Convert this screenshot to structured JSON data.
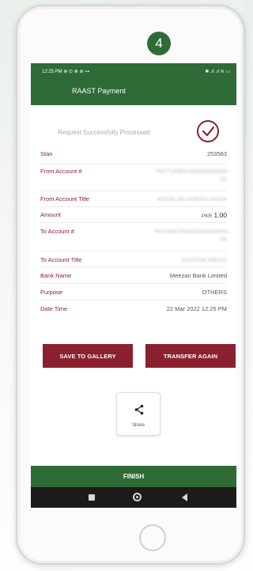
{
  "step_number": "4",
  "status_bar": {
    "time": "12:25 PM",
    "left_icons": "⊕ ⊙ ⊗ ⊛ ⊶",
    "right_icons": "✱ .ıl .ıl ≋ ▭"
  },
  "header": {
    "title": "RAAST Payment"
  },
  "status_message": "Request Successfully Processed",
  "rows": [
    {
      "label": "Stan",
      "value": "253583"
    },
    {
      "label": "From Account #",
      "value": "PK07UMBK000000000956-00",
      "blurred": true
    },
    {
      "label": "From Account Title",
      "value": "ARSALAN SHEIKH KHAN",
      "blurred": true
    },
    {
      "label": "Amount",
      "currency": "PKR",
      "amount": "1.00"
    },
    {
      "label": "To Account #",
      "value": "PK07MEZN0003260409054 - 00",
      "blurred": true
    },
    {
      "label": "To Account Title",
      "value": "SADDAM MIEAD",
      "blurred": true
    },
    {
      "label": "Bank Name",
      "value": "Meezan Bank Limited"
    },
    {
      "label": "Purpose",
      "value": "OTHERS"
    },
    {
      "label": "Date Time",
      "value": "22 Mar 2022 12:25 PM"
    }
  ],
  "buttons": {
    "save": "SAVE TO GALLERY",
    "transfer": "TRANSFER AGAIN"
  },
  "share": {
    "label": "Share"
  },
  "finish": "FINISH",
  "colors": {
    "header_green": "#2e6b36",
    "accent_maroon": "#8b2030"
  }
}
